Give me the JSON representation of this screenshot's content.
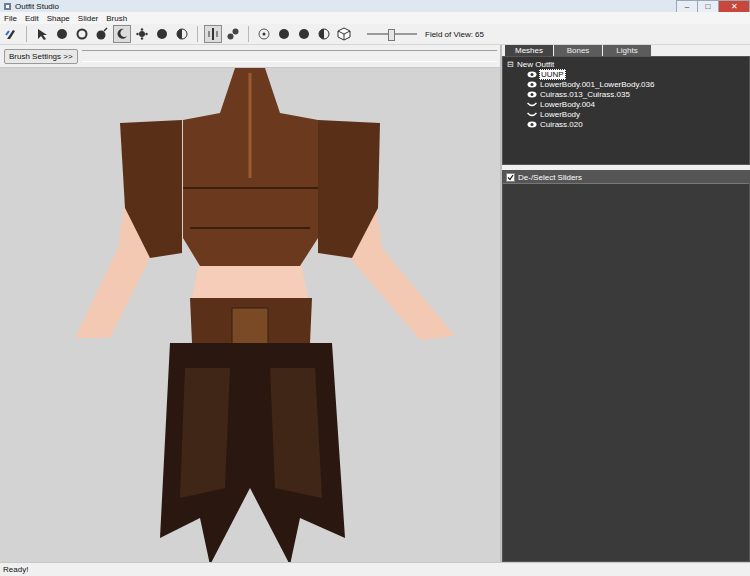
{
  "window": {
    "title": "Outfit Studio",
    "controls": [
      "–",
      "□",
      "✕"
    ]
  },
  "menu": [
    "File",
    "Edit",
    "Shape",
    "Slider",
    "Brush"
  ],
  "toolbar": {
    "tools": [
      {
        "kind": "tool",
        "selected": false
      },
      {
        "kind": "separator",
        "selected": false
      },
      {
        "kind": "tool",
        "selected": false
      },
      {
        "kind": "tool",
        "selected": false
      },
      {
        "kind": "tool",
        "selected": false
      },
      {
        "kind": "tool",
        "selected": false
      },
      {
        "kind": "tool",
        "selected": true
      },
      {
        "kind": "tool",
        "selected": false
      },
      {
        "kind": "tool",
        "selected": false
      },
      {
        "kind": "tool",
        "selected": false
      },
      {
        "kind": "separator",
        "selected": false
      },
      {
        "kind": "tool",
        "selected": true
      },
      {
        "kind": "tool",
        "selected": false
      },
      {
        "kind": "separator",
        "selected": false
      },
      {
        "kind": "tool",
        "selected": false
      },
      {
        "kind": "tool",
        "selected": false
      },
      {
        "kind": "tool",
        "selected": false
      },
      {
        "kind": "tool",
        "selected": false
      },
      {
        "kind": "tool",
        "selected": false
      }
    ],
    "fov": {
      "label": "Field of View: 65",
      "level": 0.45
    }
  },
  "brush_settings": {
    "label": "Brush Settings >>"
  },
  "tabs": [
    {
      "label": "Meshes",
      "selected": true
    },
    {
      "label": "Bones",
      "selected": false
    },
    {
      "label": "Lights",
      "selected": false
    }
  ],
  "tree": {
    "root": {
      "label": "New Outfit",
      "expanded": true,
      "glyph": "⊟"
    },
    "items": [
      {
        "label": "UUNP",
        "visible": true,
        "selected": true
      },
      {
        "label": "LowerBody.001_LowerBody.036",
        "visible": true,
        "selected": false
      },
      {
        "label": "Cuirass.013_Cuirass.035",
        "visible": true,
        "selected": false
      },
      {
        "label": "LowerBody.004",
        "visible": false,
        "selected": false
      },
      {
        "label": "LowerBody",
        "visible": false,
        "selected": false
      },
      {
        "label": "Cuirass.020",
        "visible": true,
        "selected": false
      }
    ]
  },
  "sliders": {
    "label": "De-/Select Sliders",
    "checked": true
  },
  "status_bar": "Ready!"
}
